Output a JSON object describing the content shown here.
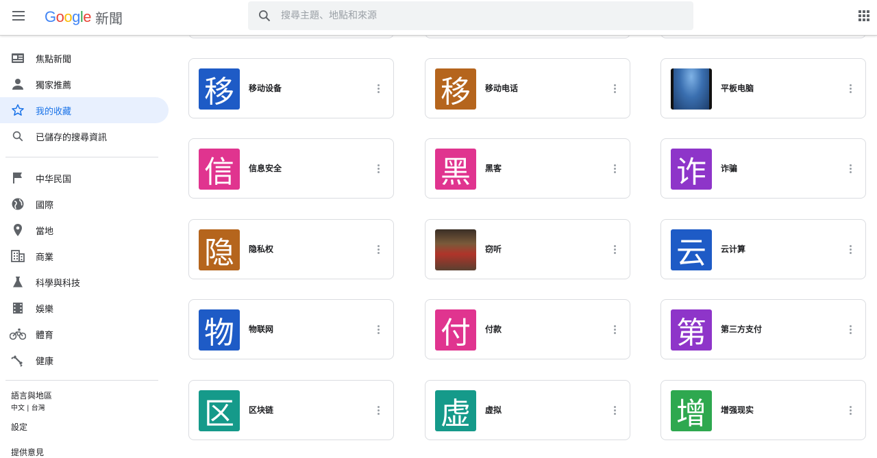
{
  "header": {
    "brand": "Google",
    "product": "新聞",
    "search_placeholder": "搜尋主題、地點和來源"
  },
  "sidebar": {
    "primary": [
      {
        "label": "焦點新聞",
        "icon": "top-stories-icon"
      },
      {
        "label": "獨家推薦",
        "icon": "person-icon"
      },
      {
        "label": "我的收藏",
        "icon": "star-icon",
        "active": true
      },
      {
        "label": "已儲存的搜尋資訊",
        "icon": "search-icon"
      }
    ],
    "sections": [
      {
        "label": "中华民国",
        "icon": "flag-icon"
      },
      {
        "label": "國際",
        "icon": "globe-icon"
      },
      {
        "label": "當地",
        "icon": "location-pin-icon"
      },
      {
        "label": "商業",
        "icon": "building-icon"
      },
      {
        "label": "科學與科技",
        "icon": "flask-icon"
      },
      {
        "label": "娛樂",
        "icon": "film-icon"
      },
      {
        "label": "體育",
        "icon": "bicycle-icon"
      },
      {
        "label": "健康",
        "icon": "fitness-icon"
      }
    ],
    "language_label": "語言與地區",
    "language_value": "中文 | 台灣",
    "settings_label": "設定",
    "feedback_label": "提供意見"
  },
  "topics": [
    {
      "title": "移动设备",
      "glyph": "移",
      "color": "#1e5bc6"
    },
    {
      "title": "移动电话",
      "glyph": "移",
      "color": "#b5651d"
    },
    {
      "title": "平板电脑",
      "glyph": "",
      "color": "#2f5f9e"
    },
    {
      "title": "信息安全",
      "glyph": "信",
      "color": "#e0348f"
    },
    {
      "title": "黑客",
      "glyph": "黑",
      "color": "#e0348f"
    },
    {
      "title": "诈骗",
      "glyph": "诈",
      "color": "#8e35c9"
    },
    {
      "title": "隐私权",
      "glyph": "隐",
      "color": "#b5651d"
    },
    {
      "title": "窃听",
      "glyph": "",
      "color": "#6b4a2f"
    },
    {
      "title": "云计算",
      "glyph": "云",
      "color": "#1e5bc6"
    },
    {
      "title": "物联网",
      "glyph": "物",
      "color": "#1e5bc6"
    },
    {
      "title": "付款",
      "glyph": "付",
      "color": "#e0348f"
    },
    {
      "title": "第三方支付",
      "glyph": "第",
      "color": "#8e35c9"
    },
    {
      "title": "区块链",
      "glyph": "区",
      "color": "#159a8a"
    },
    {
      "title": "虚拟",
      "glyph": "虚",
      "color": "#159a8a"
    },
    {
      "title": "增强现实",
      "glyph": "增",
      "color": "#2ea84f"
    }
  ]
}
